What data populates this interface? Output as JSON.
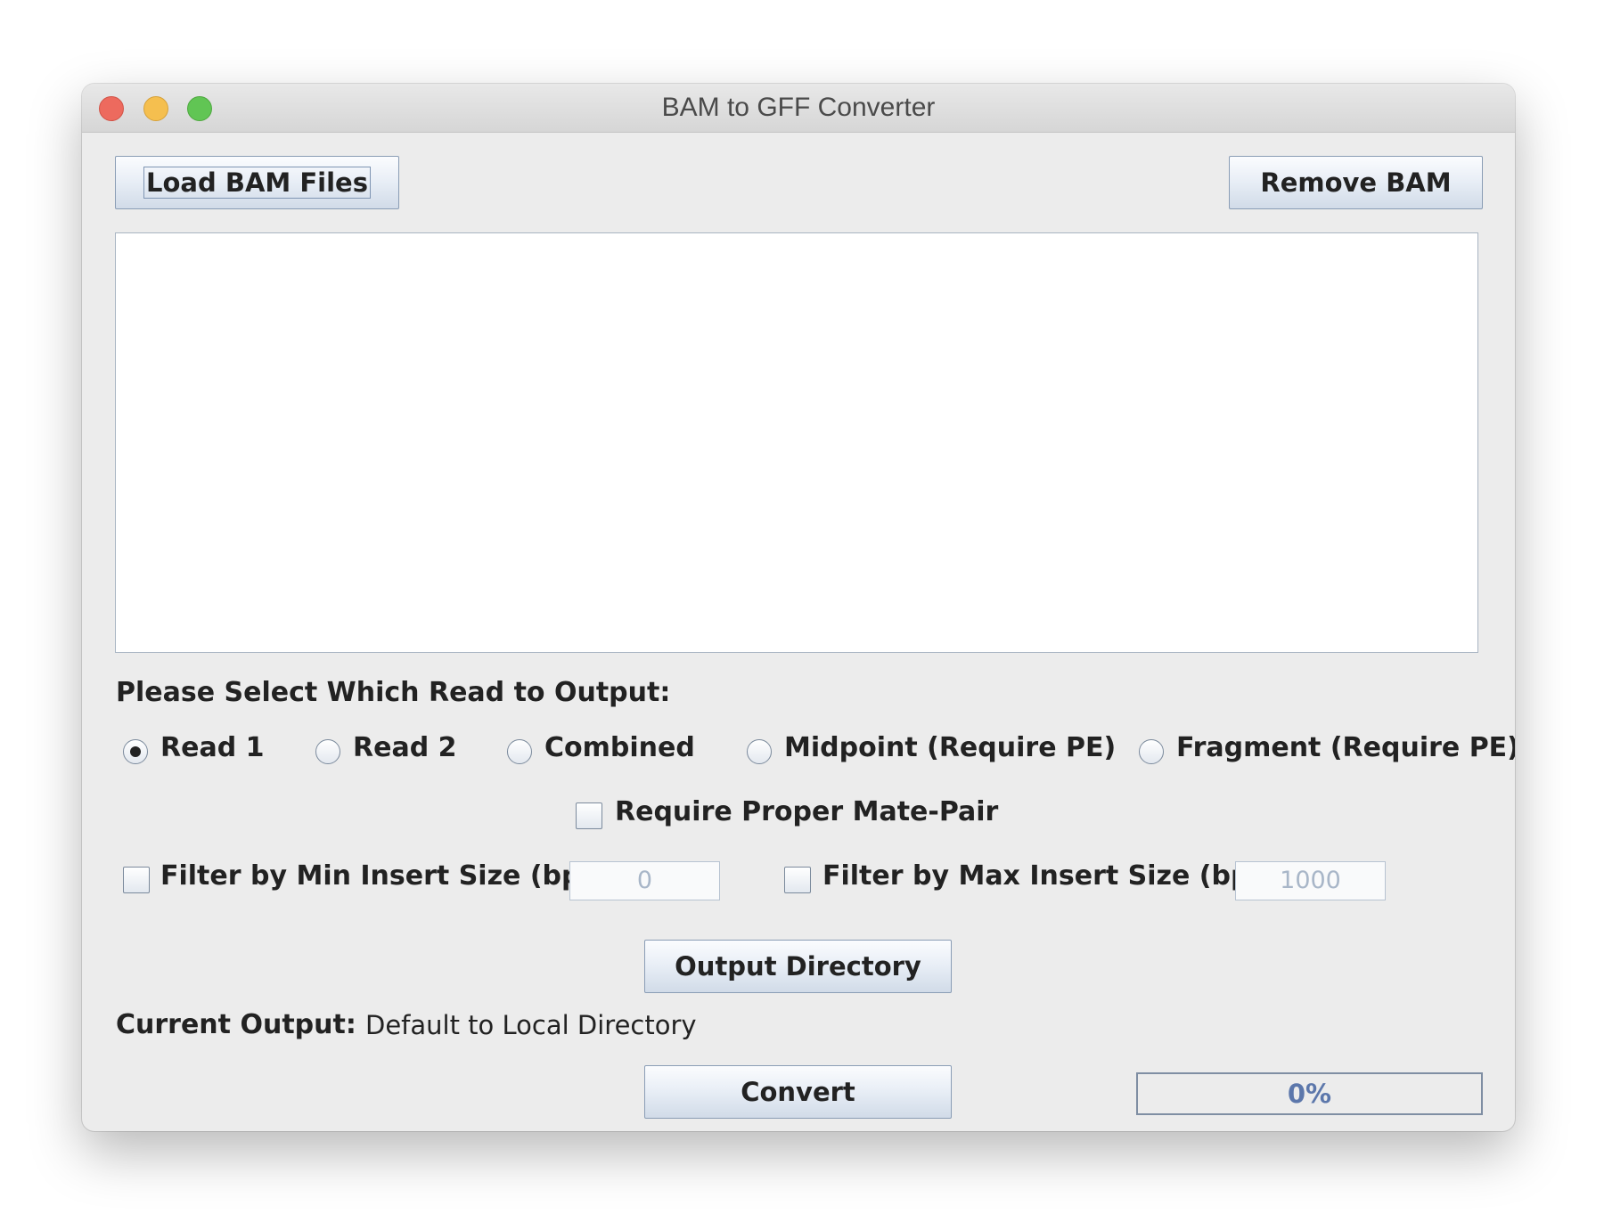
{
  "window": {
    "title": "BAM to GFF Converter"
  },
  "toolbar": {
    "load_label": "Load BAM Files",
    "remove_label": "Remove BAM"
  },
  "files": [],
  "read_section": {
    "heading": "Please Select Which Read to Output:",
    "options": [
      {
        "label": "Read 1",
        "selected": true
      },
      {
        "label": "Read 2",
        "selected": false
      },
      {
        "label": "Combined",
        "selected": false
      },
      {
        "label": "Midpoint (Require PE)",
        "selected": false
      },
      {
        "label": "Fragment (Require PE)",
        "selected": false
      }
    ]
  },
  "mate_pair": {
    "label": "Require Proper Mate-Pair",
    "checked": false
  },
  "filters": {
    "min": {
      "label": "Filter by Min Insert Size (bp)",
      "checked": false,
      "value": "0"
    },
    "max": {
      "label": "Filter by Max Insert Size (bp)",
      "checked": false,
      "value": "1000"
    }
  },
  "output": {
    "dir_button_label": "Output Directory",
    "current_label": "Current Output:",
    "current_value": "Default to Local Directory"
  },
  "convert": {
    "button_label": "Convert",
    "progress_text": "0%",
    "progress_fraction": 0
  }
}
